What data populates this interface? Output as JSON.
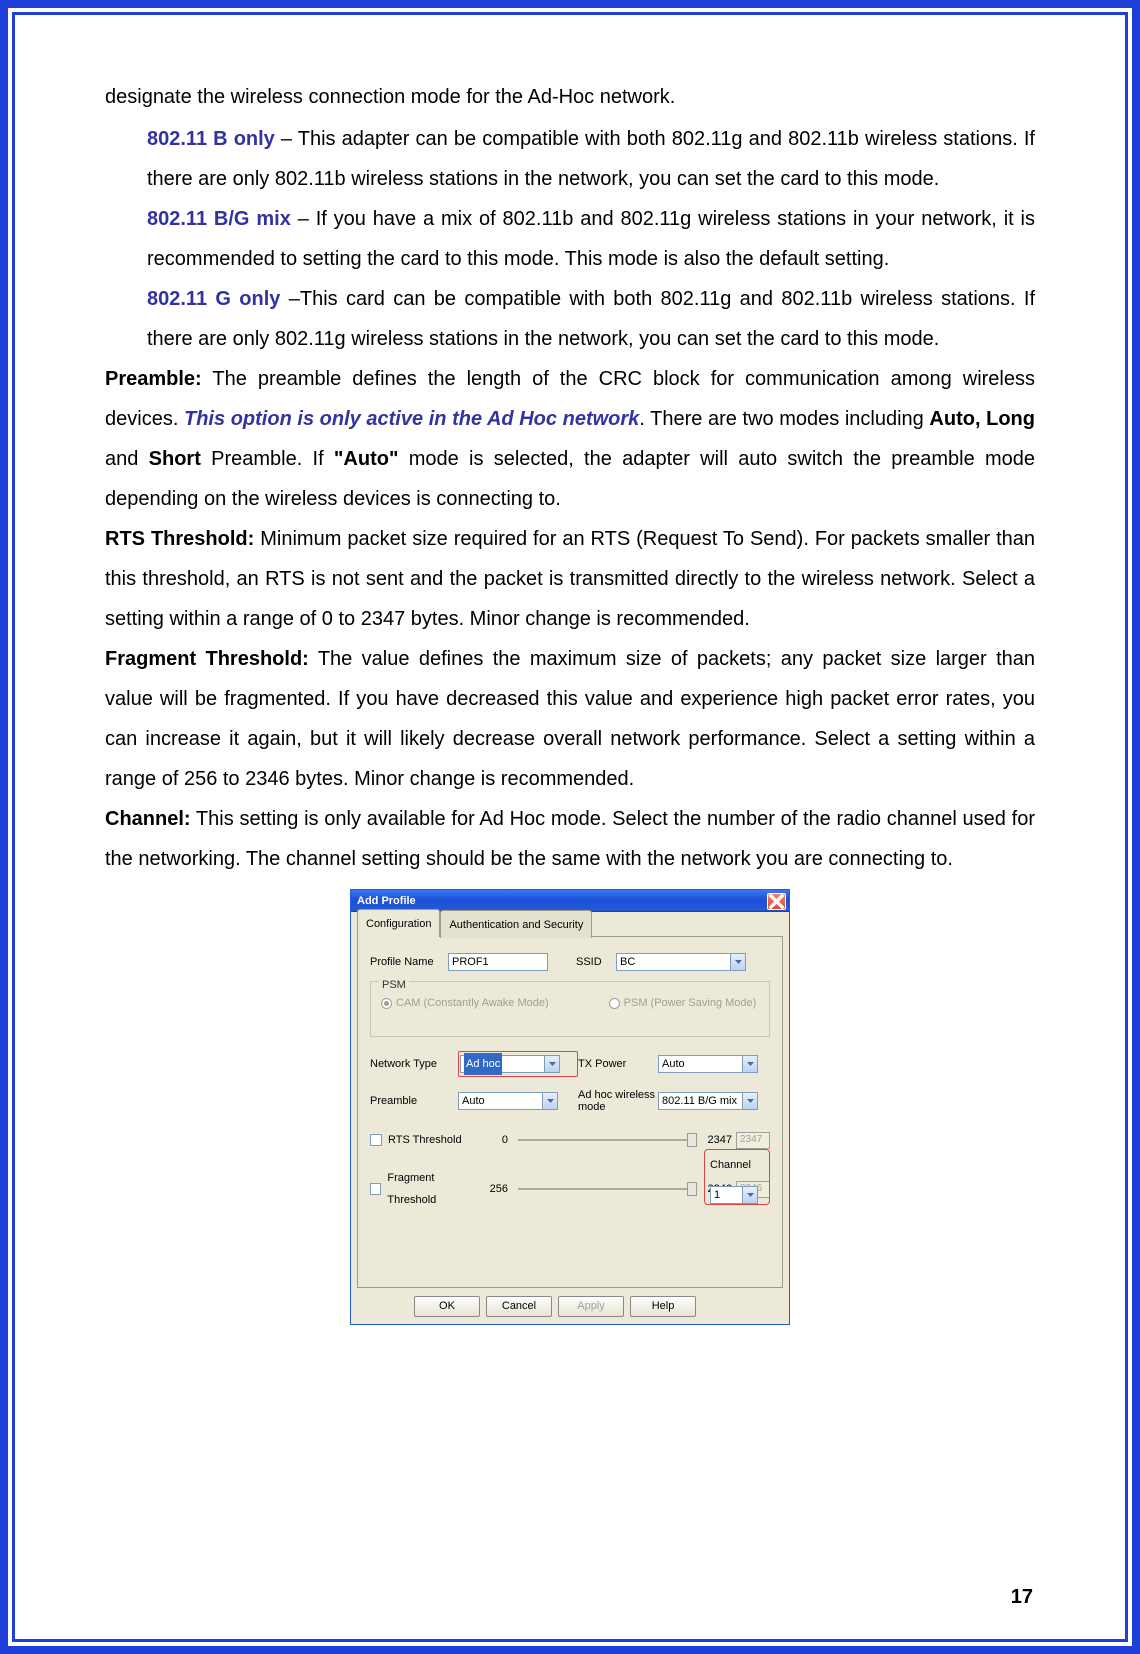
{
  "page_number": "17",
  "intro": "designate the wireless connection mode for the Ad-Hoc network.",
  "modes": [
    {
      "heading": "802.11 B only",
      "body": " – This adapter can be compatible with both 802.11g and 802.11b wireless stations. If there are only 802.11b wireless stations in the network, you can set the card to this mode."
    },
    {
      "heading": "802.11 B/G mix",
      "body": " – If you have a mix of 802.11b and 802.11g wireless stations in your network, it is recommended to setting the card to this mode. This mode is also the default setting."
    },
    {
      "heading": "802.11 G only",
      "body": " –This card can be compatible with both 802.11g and 802.11b wireless stations. If there are only 802.11g wireless stations in the network, you can set the card to this mode."
    }
  ],
  "preamble": {
    "label": "Preamble:",
    "t1": " The preamble defines the length of the CRC block for communication among wireless devices. ",
    "emph": "This option is only active in the Ad Hoc network",
    "t2": ". There are two modes including ",
    "b1": "Auto, Long",
    "t3": " and ",
    "b2": "Short",
    "t4": " Preamble. If ",
    "b3": "\"Auto\"",
    "t5": " mode is selected, the adapter will auto switch the preamble mode depending on the wireless devices is connecting to."
  },
  "rts": {
    "label": "RTS Threshold:",
    "body": " Minimum packet size required for an RTS (Request To Send). For packets smaller than this threshold, an RTS is not sent and the packet is transmitted directly to the wireless network. Select a setting within a range of 0 to 2347 bytes. Minor change is recommended."
  },
  "frag": {
    "label": "Fragment Threshold:",
    "body": " The value defines the maximum size of packets; any packet size larger than value will be fragmented. If you have decreased this value and experience high packet error rates, you can increase it again, but it will likely decrease overall network performance. Select a setting within a range of 256 to 2346 bytes. Minor change is recommended."
  },
  "channel": {
    "label": "Channel:",
    "body": " This setting is only available for Ad Hoc mode. Select the number of the radio channel used for the networking. The channel setting should be the same with the network you are connecting to."
  },
  "dialog": {
    "title": "Add Profile",
    "tabs": {
      "configuration": "Configuration",
      "auth": "Authentication and Security"
    },
    "profile_name_label": "Profile Name",
    "profile_name_value": "PROF1",
    "ssid_label": "SSID",
    "ssid_value": "BC",
    "psm_legend": "PSM",
    "psm_cam": "CAM (Constantly Awake Mode)",
    "psm_psm": "PSM (Power Saving Mode)",
    "network_type_label": "Network Type",
    "network_type_value": "Ad hoc",
    "tx_power_label": "TX Power",
    "tx_power_value": "Auto",
    "preamble_label": "Preamble",
    "preamble_value": "Auto",
    "adhoc_mode_label": "Ad hoc wireless mode",
    "adhoc_mode_value": "802.11 B/G mix",
    "rts_label": "RTS Threshold",
    "rts_min": "0",
    "rts_max": "2347",
    "rts_value": "2347",
    "frag_label": "Fragment Threshold",
    "frag_min": "256",
    "frag_max": "2346",
    "frag_value": "2346",
    "channel_label": "Channel",
    "channel_value": "1",
    "buttons": {
      "ok": "OK",
      "cancel": "Cancel",
      "apply": "Apply",
      "help": "Help"
    }
  }
}
